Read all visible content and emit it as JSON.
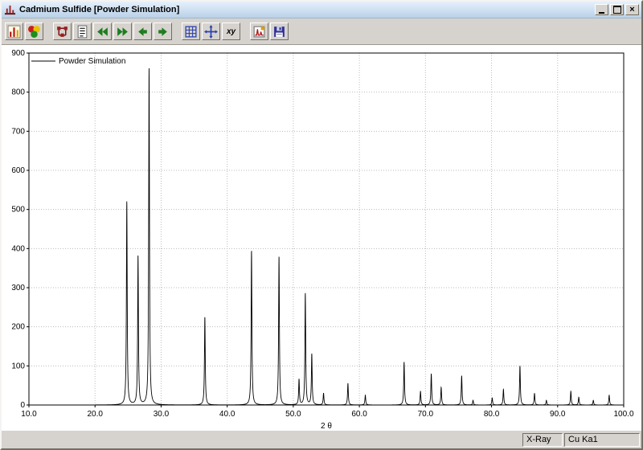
{
  "window": {
    "title": "Cadmium Sulfide [Powder Simulation]",
    "close_glyph": "×"
  },
  "toolbar": {
    "xy_label": "xy",
    "buttons": [
      "pattern-histogram",
      "display-colors",
      "crystal-structure",
      "data-list",
      "fast-rewind",
      "fast-forward",
      "step-back",
      "step-forward",
      "grid",
      "crosshair",
      "xy-axes",
      "copy-pattern",
      "save"
    ]
  },
  "statusbar": {
    "panels": [
      "X-Ray",
      "Cu Ka1"
    ]
  },
  "colors": {
    "window_bg": "#d6d3ce",
    "titlebar_from": "#e6f0fb",
    "titlebar_to": "#b9d1e9",
    "grid": "#bbbbbb",
    "line": "#000000",
    "arrow_green": "#1e7d1e",
    "tool_blue": "#2a3fae",
    "tool_red": "#8b1a1a"
  },
  "chart_data": {
    "type": "line",
    "title": "",
    "xlabel": "2 θ",
    "ylabel": "",
    "legend": [
      "Powder Simulation"
    ],
    "legend_position": "top-left-inside",
    "xlim": [
      10,
      100
    ],
    "ylim": [
      0,
      900
    ],
    "x_tick_step": 10,
    "y_tick_step": 100,
    "grid": true,
    "grid_style": "dotted",
    "peak_profile": "lorentzian",
    "peak_hwhm_deg": 0.07,
    "peaks": [
      {
        "two_theta": 24.81,
        "intensity": 520
      },
      {
        "two_theta": 26.51,
        "intensity": 380
      },
      {
        "two_theta": 28.18,
        "intensity": 860
      },
      {
        "two_theta": 36.62,
        "intensity": 225
      },
      {
        "two_theta": 43.68,
        "intensity": 395
      },
      {
        "two_theta": 47.84,
        "intensity": 380
      },
      {
        "two_theta": 50.87,
        "intensity": 65
      },
      {
        "two_theta": 51.82,
        "intensity": 285
      },
      {
        "two_theta": 52.8,
        "intensity": 130
      },
      {
        "two_theta": 54.58,
        "intensity": 30
      },
      {
        "two_theta": 58.27,
        "intensity": 55
      },
      {
        "two_theta": 60.9,
        "intensity": 25
      },
      {
        "two_theta": 66.77,
        "intensity": 110
      },
      {
        "two_theta": 69.25,
        "intensity": 35
      },
      {
        "two_theta": 70.88,
        "intensity": 80
      },
      {
        "two_theta": 72.38,
        "intensity": 45
      },
      {
        "two_theta": 75.48,
        "intensity": 75
      },
      {
        "two_theta": 77.2,
        "intensity": 12
      },
      {
        "two_theta": 80.1,
        "intensity": 18
      },
      {
        "two_theta": 81.8,
        "intensity": 40
      },
      {
        "two_theta": 84.3,
        "intensity": 100
      },
      {
        "two_theta": 86.5,
        "intensity": 30
      },
      {
        "two_theta": 88.3,
        "intensity": 12
      },
      {
        "two_theta": 92.0,
        "intensity": 35
      },
      {
        "two_theta": 93.2,
        "intensity": 20
      },
      {
        "two_theta": 95.4,
        "intensity": 12
      },
      {
        "two_theta": 97.8,
        "intensity": 25
      }
    ]
  }
}
